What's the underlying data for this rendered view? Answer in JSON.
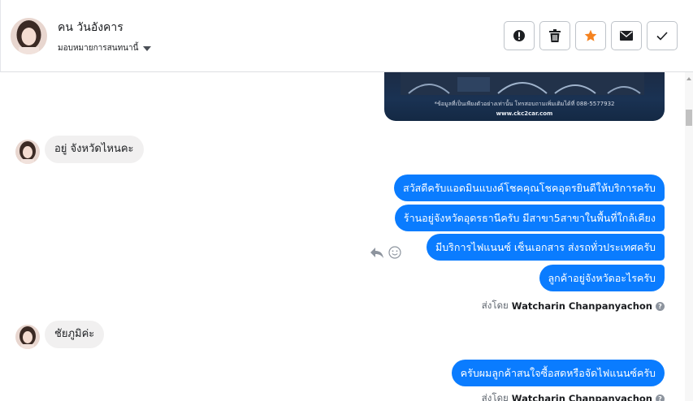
{
  "header": {
    "contact_name": "คน วันอังคาร",
    "assign_label": "มอบหมายการสนทนานี้",
    "toolbar": [
      {
        "name": "mark-spam-button",
        "icon": "alert-icon"
      },
      {
        "name": "delete-button",
        "icon": "trash-icon"
      },
      {
        "name": "star-button",
        "icon": "star-icon",
        "color": "#f5821f"
      },
      {
        "name": "mark-unread-button",
        "icon": "envelope-icon"
      },
      {
        "name": "mark-done-button",
        "icon": "check-icon"
      }
    ]
  },
  "attachment": {
    "disclaimer": "*ข้อมูลที่เป็นเพียงตัวอย่างเท่านั้น โทรสอบถามเพิ่มเติมได้ที่ 088-5577932",
    "site": "www.ckc2car.com"
  },
  "messages": {
    "in_1": "อยู่ จังหวัดไหนคะ",
    "out_1": "สวัสดีครับแอดมินแบงค์โชคคุณโชคอุดรยินดีให้บริการครับ",
    "out_2": "ร้านอยู่จังหวัดอุดรธานีครับ มีสาขา5สาขาในพื้นที่ใกล้เคียง",
    "out_3": "มีบริการไฟแนนซ์ เซ็นเอกสาร ส่งรถทั่วประเทศครับ",
    "out_4": "ลูกค้าอยู่จังหวัดอะไรครับ",
    "in_2": "ชัยภูมิค่ะ",
    "out_5": "ครับผมลูกค้าสนใจซื้อสดหรือจัดไฟแนนซ์ครับ"
  },
  "sent_by": {
    "label": "ส่งโดย",
    "agent": "Watcharin Chanpanyachon",
    "help": "?"
  },
  "colors": {
    "outgoing_bubble": "#0a7cff",
    "incoming_bubble": "#f1f0f0",
    "star": "#f5821f"
  }
}
